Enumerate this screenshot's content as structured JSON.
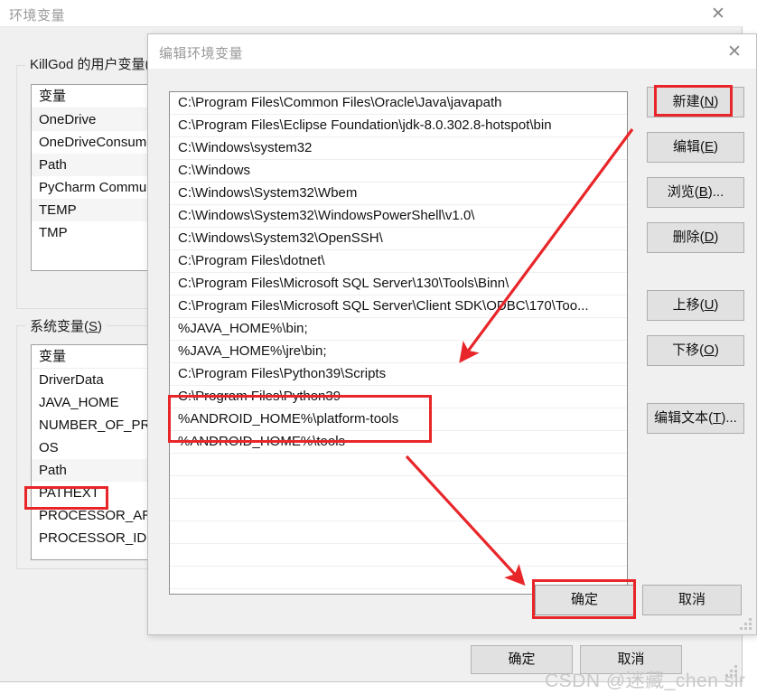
{
  "parent_window": {
    "title": "环境变量",
    "close_icon": "close-icon",
    "user_vars": {
      "group_label": "KillGod 的用户变量(U)",
      "column_header": "变量",
      "rows": [
        "OneDrive",
        "OneDriveConsumer",
        "Path",
        "PyCharm Community Edition",
        "TEMP",
        "TMP"
      ]
    },
    "system_vars": {
      "group_label": "系统变量(S)",
      "column_header": "变量",
      "rows": [
        "DriverData",
        "JAVA_HOME",
        "NUMBER_OF_PROCESSORS",
        "OS",
        "Path",
        "PATHEXT",
        "PROCESSOR_ARCHITECTURE",
        "PROCESSOR_IDENTIFIER"
      ],
      "highlighted_row": "Path"
    },
    "buttons": {
      "ok": "确定",
      "cancel": "取消"
    }
  },
  "child_dialog": {
    "title": "编辑环境变量",
    "close_icon": "close-icon",
    "path_entries": [
      "C:\\Program Files\\Common Files\\Oracle\\Java\\javapath",
      "C:\\Program Files\\Eclipse Foundation\\jdk-8.0.302.8-hotspot\\bin",
      "C:\\Windows\\system32",
      "C:\\Windows",
      "C:\\Windows\\System32\\Wbem",
      "C:\\Windows\\System32\\WindowsPowerShell\\v1.0\\",
      "C:\\Windows\\System32\\OpenSSH\\",
      "C:\\Program Files\\dotnet\\",
      "C:\\Program Files\\Microsoft SQL Server\\130\\Tools\\Binn\\",
      "C:\\Program Files\\Microsoft SQL Server\\Client SDK\\ODBC\\170\\Too...",
      "%JAVA_HOME%\\bin;",
      "%JAVA_HOME%\\jre\\bin;",
      "C:\\Program Files\\Python39\\Scripts",
      "C:\\Program Files\\Python39",
      "%ANDROID_HOME%\\platform-tools",
      "%ANDROID_HOME%\\tools"
    ],
    "side_buttons": [
      {
        "label_main": "新建(",
        "label_acc": "N",
        "label_tail": ")",
        "name": "new-button"
      },
      {
        "label_main": "编辑(",
        "label_acc": "E",
        "label_tail": ")",
        "name": "edit-button"
      },
      {
        "label_main": "浏览(",
        "label_acc": "B",
        "label_tail": ")...",
        "name": "browse-button"
      },
      {
        "label_main": "删除(",
        "label_acc": "D",
        "label_tail": ")",
        "name": "delete-button"
      },
      {
        "label_main": "上移(",
        "label_acc": "U",
        "label_tail": ")",
        "name": "move-up-button"
      },
      {
        "label_main": "下移(",
        "label_acc": "O",
        "label_tail": ")",
        "name": "move-down-button"
      },
      {
        "label_main": "编辑文本(",
        "label_acc": "T",
        "label_tail": ")...",
        "name": "edit-text-button"
      }
    ],
    "buttons": {
      "ok": "确定",
      "cancel": "取消"
    }
  },
  "annotations": {
    "accent_color": "#e8262a",
    "highlight_new_button": "新建(N)",
    "highlight_android_entries": [
      "%ANDROID_HOME%\\platform-tools",
      "%ANDROID_HOME%\\tools"
    ],
    "highlight_ok_button": "确定",
    "highlight_path_row": "Path"
  },
  "watermark": {
    "text": "CSDN @迷藏_chen sir"
  }
}
